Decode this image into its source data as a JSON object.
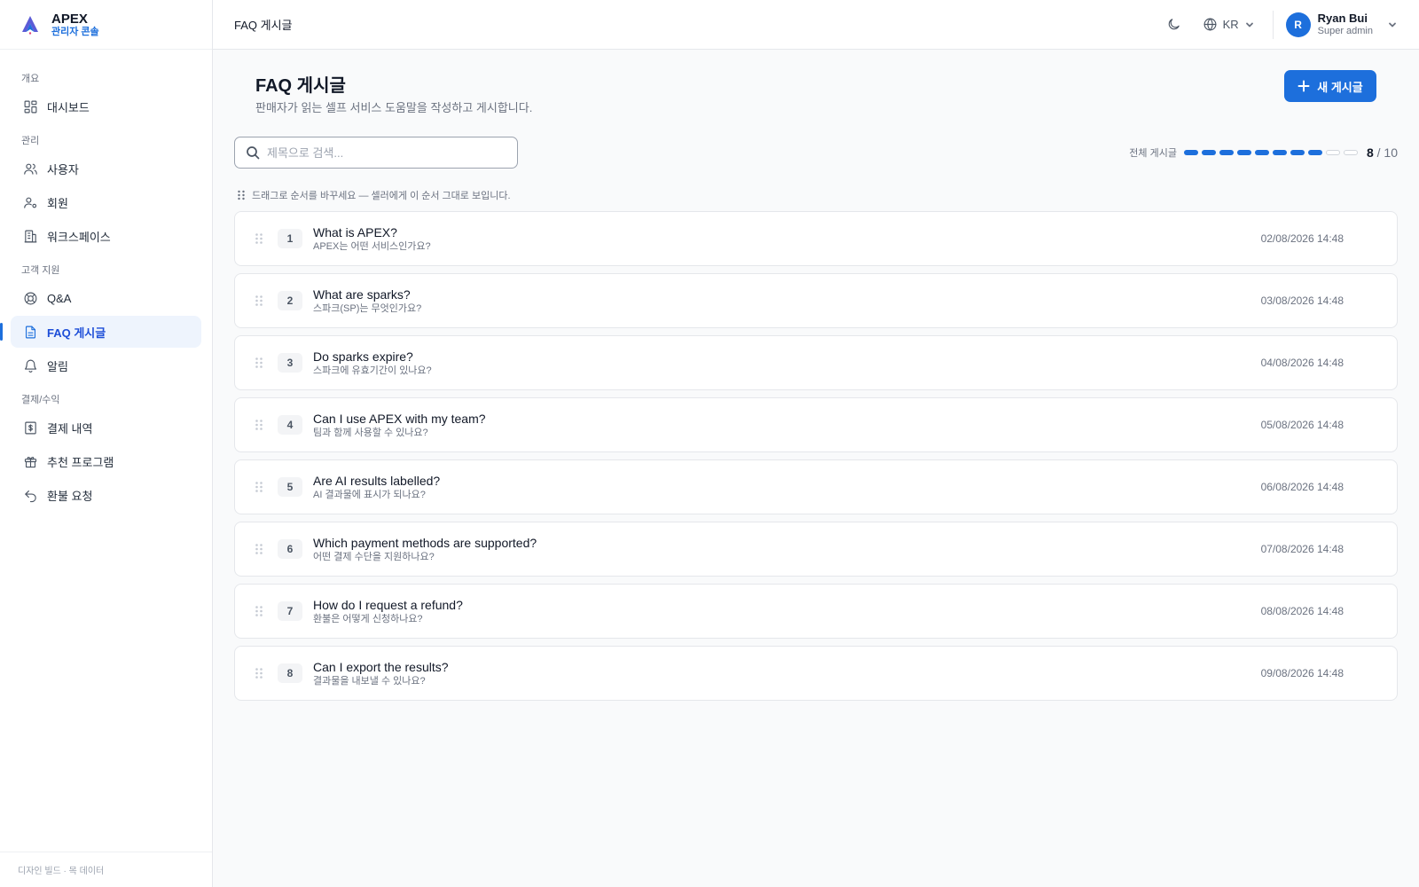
{
  "brand": {
    "name": "APEX",
    "subtitle": "관리자 콘솔"
  },
  "sidebar": {
    "sections": [
      {
        "title": "개요",
        "items": [
          {
            "label": "대시보드",
            "icon": "dashboard-icon"
          }
        ]
      },
      {
        "title": "관리",
        "items": [
          {
            "label": "사용자",
            "icon": "users-icon"
          },
          {
            "label": "회원",
            "icon": "member-icon"
          },
          {
            "label": "워크스페이스",
            "icon": "building-icon"
          }
        ]
      },
      {
        "title": "고객 지원",
        "items": [
          {
            "label": "Q&A",
            "icon": "lifebuoy-icon"
          },
          {
            "label": "FAQ 게시글",
            "icon": "document-icon",
            "active": true
          },
          {
            "label": "알림",
            "icon": "bell-icon"
          }
        ]
      },
      {
        "title": "결제/수익",
        "items": [
          {
            "label": "결제 내역",
            "icon": "receipt-icon"
          },
          {
            "label": "추천 프로그램",
            "icon": "gift-icon"
          },
          {
            "label": "환불 요청",
            "icon": "undo-icon"
          }
        ]
      }
    ],
    "footer": "디자인 빌드 · 목 데이터"
  },
  "topbar": {
    "title": "FAQ 게시글",
    "language": "KR",
    "user": {
      "initial": "R",
      "name": "Ryan Bui",
      "role": "Super admin"
    }
  },
  "page": {
    "title": "FAQ 게시글",
    "description": "판매자가 읽는 셀프 서비스 도움말을 작성하고 게시합니다.",
    "new_button": "새 게시글",
    "search_placeholder": "제목으로 검색...",
    "quota_label": "전체 게시글",
    "quota_used": "8",
    "quota_total": "/ 10",
    "quota_fraction": 0.8,
    "hint": "드래그로 순서를 바꾸세요 — 셀러에게 이 순서 그대로 보입니다."
  },
  "faqs": [
    {
      "num": "1",
      "title": "What is APEX?",
      "subtitle": "APEX는 어떤 서비스인가요?",
      "date": "02/08/2026 14:48"
    },
    {
      "num": "2",
      "title": "What are sparks?",
      "subtitle": "스파크(SP)는 무엇인가요?",
      "date": "03/08/2026 14:48"
    },
    {
      "num": "3",
      "title": "Do sparks expire?",
      "subtitle": "스파크에 유효기간이 있나요?",
      "date": "04/08/2026 14:48"
    },
    {
      "num": "4",
      "title": "Can I use APEX with my team?",
      "subtitle": "팀과 함께 사용할 수 있나요?",
      "date": "05/08/2026 14:48"
    },
    {
      "num": "5",
      "title": "Are AI results labelled?",
      "subtitle": "AI 결과물에 표시가 되나요?",
      "date": "06/08/2026 14:48"
    },
    {
      "num": "6",
      "title": "Which payment methods are supported?",
      "subtitle": "어떤 결제 수단을 지원하나요?",
      "date": "07/08/2026 14:48"
    },
    {
      "num": "7",
      "title": "How do I request a refund?",
      "subtitle": "환불은 어떻게 신청하나요?",
      "date": "08/08/2026 14:48"
    },
    {
      "num": "8",
      "title": "Can I export the results?",
      "subtitle": "결과물을 내보낼 수 있나요?",
      "date": "09/08/2026 14:48"
    }
  ],
  "colors": {
    "accent": "#1d6fdc",
    "active_bg": "#eef4fd",
    "border": "#e5e7eb"
  }
}
